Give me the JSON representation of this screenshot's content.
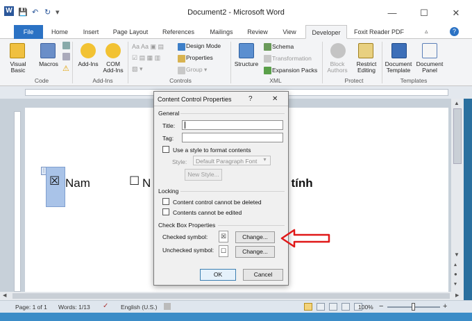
{
  "window": {
    "title": "Document2 - Microsoft Word",
    "min": "—",
    "max": "☐",
    "close": "✕"
  },
  "qat": {
    "save": "💾",
    "undo": "↶",
    "redo": "↻",
    "customize": "▾"
  },
  "tabs": [
    "File",
    "Home",
    "Insert",
    "Page Layout",
    "References",
    "Mailings",
    "Review",
    "View",
    "Developer",
    "Foxit Reader PDF"
  ],
  "active_tab": "Developer",
  "ribbon": {
    "code": {
      "label": "Code",
      "visual_basic": "Visual Basic",
      "macros": "Macros"
    },
    "addins": {
      "label": "Add-Ins",
      "addins": "Add-Ins",
      "com": "COM Add-Ins"
    },
    "controls": {
      "label": "Controls",
      "design_mode": "Design Mode",
      "properties": "Properties",
      "group": "Group ▾"
    },
    "xml": {
      "label": "XML",
      "structure": "Structure",
      "schema": "Schema",
      "transformation": "Transformation",
      "expansion": "Expansion Packs"
    },
    "protect": {
      "label": "Protect",
      "block": "Block Authors",
      "restrict": "Restrict Editing"
    },
    "templates": {
      "label": "Templates",
      "doc_template": "Document Template",
      "doc_panel": "Document Panel"
    }
  },
  "document": {
    "checked_glyph": "☒",
    "item1": "Nam",
    "unchecked_glyph": "☐",
    "item2": "N",
    "item3": "ì tính"
  },
  "dialog": {
    "title": "Content Control Properties",
    "help": "?",
    "close": "✕",
    "general": "General",
    "title_label": "Title:",
    "title_value": "",
    "tag_label": "Tag:",
    "tag_value": "",
    "use_style": "Use a style to format contents",
    "style_label": "Style:",
    "style_value": "Default Paragraph Font",
    "new_style": "New Style...",
    "locking": "Locking",
    "cannot_delete": "Content control cannot be deleted",
    "cannot_edit": "Contents cannot be edited",
    "checkbox_props": "Check Box Properties",
    "checked_symbol": "Checked symbol:",
    "checked_glyph": "☒",
    "unchecked_symbol": "Unchecked symbol:",
    "unchecked_glyph": "☐",
    "change": "Change...",
    "ok": "OK",
    "cancel": "Cancel"
  },
  "status": {
    "page": "Page: 1 of 1",
    "words": "Words: 1/13",
    "language": "English (U.S.)",
    "zoom": "100%",
    "zoom_out": "−",
    "zoom_in": "+"
  },
  "colors": {
    "accent": "#2b72c4",
    "arrow": "#e01818"
  }
}
